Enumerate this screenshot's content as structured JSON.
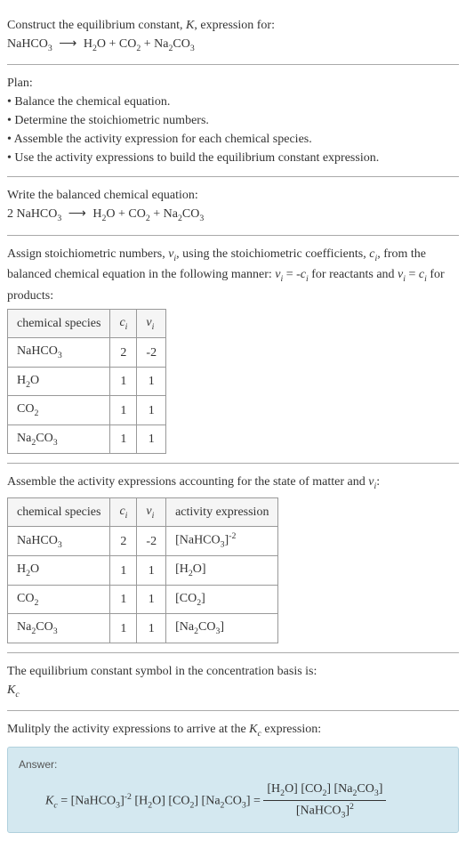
{
  "intro": {
    "prompt": "Construct the equilibrium constant, ",
    "K": "K",
    "prompt2": ", expression for:",
    "equation_lhs": "NaHCO",
    "equation_rhs_1": "H",
    "equation_rhs_1b": "O + CO",
    "equation_rhs_2": " + Na",
    "equation_rhs_3": "CO"
  },
  "plan": {
    "title": "Plan:",
    "items": [
      "Balance the chemical equation.",
      "Determine the stoichiometric numbers.",
      "Assemble the activity expression for each chemical species.",
      "Use the activity expressions to build the equilibrium constant expression."
    ]
  },
  "balanced": {
    "title": "Write the balanced chemical equation:",
    "coef": "2 NaHCO",
    "rhs": "H",
    "rhs2": "O + CO",
    "rhs3": " + Na",
    "rhs4": "CO"
  },
  "stoich": {
    "text1": "Assign stoichiometric numbers, ",
    "nu": "ν",
    "i": "i",
    "text2": ", using the stoichiometric coefficients, ",
    "c": "c",
    "text3": ", from the balanced chemical equation in the following manner: ",
    "eq1": " = -",
    "text4": " for reactants and ",
    "eq2": " = ",
    "text5": " for products:",
    "table": {
      "h1": "chemical species",
      "h2": "c",
      "h3": "ν",
      "rows": [
        {
          "sp_a": "NaHCO",
          "sp_sub": "3",
          "c": "2",
          "nu": "-2"
        },
        {
          "sp_a": "H",
          "sp_sub": "2",
          "sp_b": "O",
          "c": "1",
          "nu": "1"
        },
        {
          "sp_a": "CO",
          "sp_sub": "2",
          "sp_b": "",
          "c": "1",
          "nu": "1"
        },
        {
          "sp_a": "Na",
          "sp_sub": "2",
          "sp_b": "CO",
          "sp_sub2": "3",
          "c": "1",
          "nu": "1"
        }
      ]
    }
  },
  "activity": {
    "text": "Assemble the activity expressions accounting for the state of matter and ",
    "table": {
      "h1": "chemical species",
      "h2": "c",
      "h3": "ν",
      "h4": "activity expression",
      "rows": [
        {
          "sp": "NaHCO",
          "sub": "3",
          "c": "2",
          "nu": "-2",
          "act": "[NaHCO",
          "act_sub": "3",
          "act_end": "]",
          "act_sup": "-2"
        },
        {
          "sp": "H",
          "sub": "2",
          "sp2": "O",
          "c": "1",
          "nu": "1",
          "act": "[H",
          "act_sub": "2",
          "act_end": "O]"
        },
        {
          "sp": "CO",
          "sub": "2",
          "c": "1",
          "nu": "1",
          "act": "[CO",
          "act_sub": "2",
          "act_end": "]"
        },
        {
          "sp": "Na",
          "sub": "2",
          "sp2": "CO",
          "sub2": "3",
          "c": "1",
          "nu": "1",
          "act": "[Na",
          "act_sub": "2",
          "act_mid": "CO",
          "act_sub2": "3",
          "act_end": "]"
        }
      ]
    }
  },
  "kc_symbol": {
    "text": "The equilibrium constant symbol in the concentration basis is:",
    "sym": "K",
    "sub": "c"
  },
  "multiply": {
    "text": "Mulitply the activity expressions to arrive at the ",
    "K": "K",
    "c": "c",
    "text2": " expression:"
  },
  "answer": {
    "label": "Answer:",
    "Kc": "K",
    "c": "c",
    "eq": " = [NaHCO",
    "s3": "3",
    "e1": "]",
    "sup_neg2": "-2",
    "e2": " [H",
    "s2": "2",
    "e3": "O] [CO",
    "e4": "] [Na",
    "e5": "CO",
    "e6": "] = ",
    "num1": "[H",
    "num2": "O] [CO",
    "num3": "] [Na",
    "num4": "CO",
    "num5": "]",
    "den1": "[NaHCO",
    "den2": "]",
    "den_sup": "2"
  },
  "subscripts": {
    "two": "2",
    "three": "3",
    "i": "i"
  },
  "glyphs": {
    "arrow": "⟶"
  }
}
